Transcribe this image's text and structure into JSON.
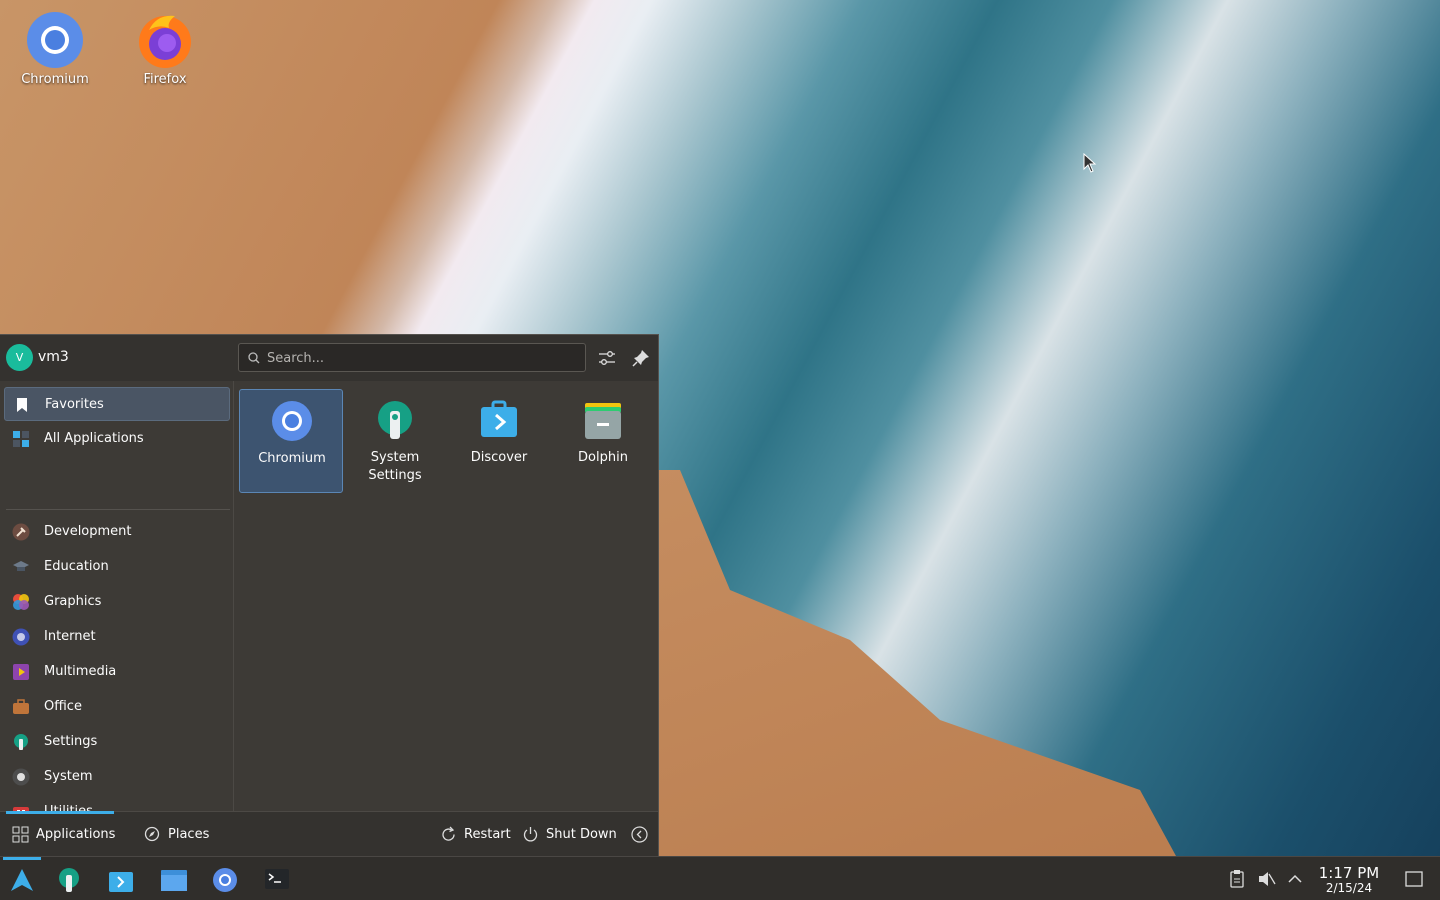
{
  "desktop": {
    "icons": [
      {
        "label": "Chromium",
        "icon": "chromium-icon"
      },
      {
        "label": "Firefox",
        "icon": "firefox-icon"
      }
    ]
  },
  "launcher": {
    "user": {
      "initial": "V",
      "name": "vm3"
    },
    "search": {
      "placeholder": "Search..."
    },
    "sidebar": {
      "items": [
        {
          "label": "Favorites",
          "icon": "bookmark-icon"
        },
        {
          "label": "All Applications",
          "icon": "all-apps-icon"
        },
        {
          "label": "Development",
          "icon": "hammer-icon"
        },
        {
          "label": "Education",
          "icon": "graduation-cap-icon"
        },
        {
          "label": "Graphics",
          "icon": "color-wheel-icon"
        },
        {
          "label": "Internet",
          "icon": "globe-icon"
        },
        {
          "label": "Multimedia",
          "icon": "film-icon"
        },
        {
          "label": "Office",
          "icon": "briefcase-icon"
        },
        {
          "label": "Settings",
          "icon": "settings-wrench-icon"
        },
        {
          "label": "System",
          "icon": "system-icon"
        },
        {
          "label": "Utilities",
          "icon": "toolbox-icon"
        }
      ]
    },
    "favorites": [
      {
        "label": "Chromium",
        "icon": "chromium-icon"
      },
      {
        "label": "System\nSettings",
        "icon": "system-settings-icon"
      },
      {
        "label": "Discover",
        "icon": "discover-icon"
      },
      {
        "label": "Dolphin",
        "icon": "dolphin-icon"
      }
    ],
    "footer": {
      "applications_label": "Applications",
      "places_label": "Places",
      "restart_label": "Restart",
      "shutdown_label": "Shut Down"
    }
  },
  "taskbar": {
    "items": [
      {
        "name": "application-launcher",
        "icon": "arch-logo-icon"
      },
      {
        "name": "system-settings",
        "icon": "system-settings-icon"
      },
      {
        "name": "discover",
        "icon": "discover-icon"
      },
      {
        "name": "dolphin",
        "icon": "folder-icon"
      },
      {
        "name": "chromium",
        "icon": "chromium-icon"
      },
      {
        "name": "konsole",
        "icon": "terminal-icon"
      }
    ],
    "tray": {
      "icons": [
        "clipboard-icon",
        "volume-muted-icon",
        "chevron-up-icon"
      ],
      "time": "1:17 PM",
      "date": "2/15/24"
    }
  },
  "colors": {
    "accent": "#3daee9",
    "panel_bg": "#3d3a36",
    "selection": "#3d5470"
  }
}
